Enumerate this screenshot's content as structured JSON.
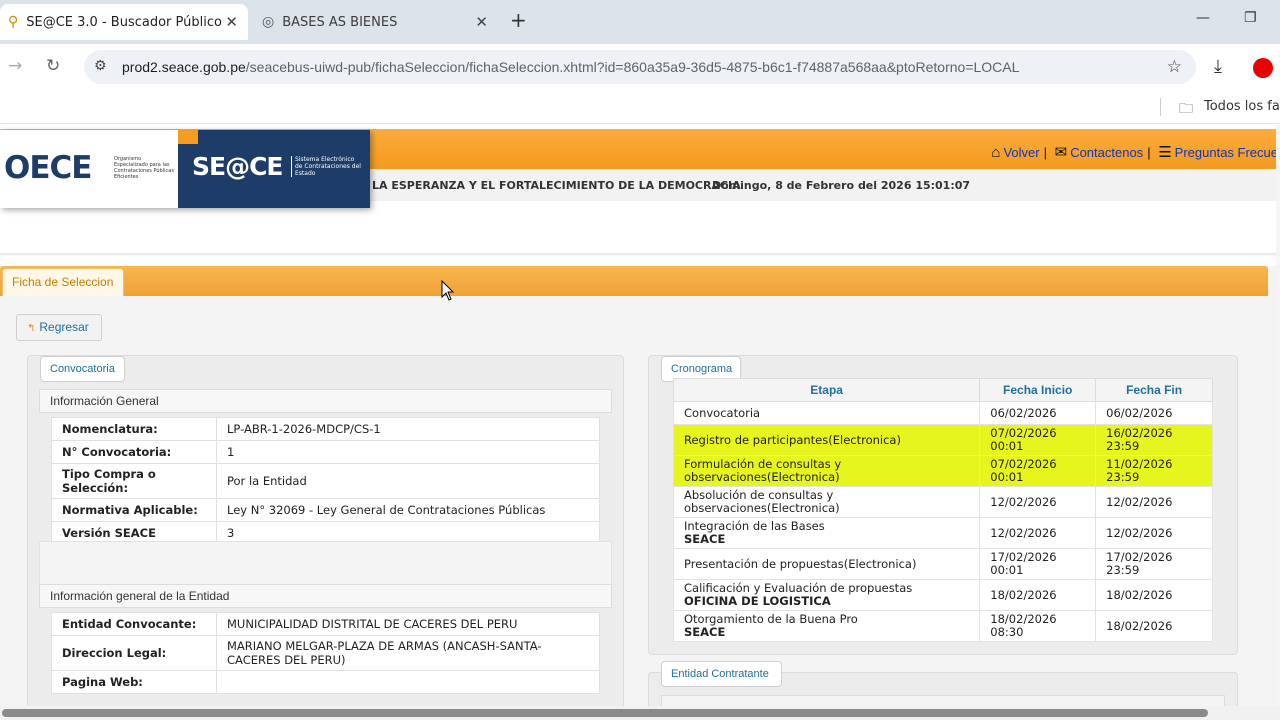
{
  "browser": {
    "tabs": [
      {
        "title": "SE@CE 3.0 - Buscador Público",
        "close": "✕"
      },
      {
        "title": "BASES AS BIENES",
        "close": "✕"
      }
    ],
    "new_tab": "+",
    "url_host": "prod2.seace.gob.pe",
    "url_path": "/seacebus-uiwd-pub/fichaSeleccion/fichaSeleccion.xhtml?id=860a35a9-36d5-4875-b6c1-f74887a568aa&ptoRetorno=LOCAL",
    "bookmarks_label": "Todos los fav"
  },
  "header": {
    "links": {
      "volver": "Volver",
      "contactenos": "Contactenos",
      "preguntas": "Preguntas Frecue"
    },
    "lema": "LA ESPERANZA Y EL FORTALECIMIENTO DE LA DEMOCRACIA",
    "fecha": "Domingo, 8 de Febrero del 2026  15:01:07",
    "oece_logo": "OECE",
    "oece_sub": "Organismo Especializado para las Contrataciones Públicas Eficientes",
    "seace_logo": "SE@CE",
    "seace_sub": "Sistema Electrónico de Contrataciones del Estado"
  },
  "ficha": {
    "tab": "Ficha de Seleccion",
    "regresar": "Regresar",
    "convocatoria": {
      "legend": "Convocatoria",
      "info_general_title": "Información General",
      "info_general": [
        {
          "label": "Nomenclatura:",
          "value": "LP-ABR-1-2026-MDCP/CS-1"
        },
        {
          "label": "N° Convocatoria:",
          "value": "1"
        },
        {
          "label": "Tipo Compra o Selección:",
          "value": "Por la Entidad"
        },
        {
          "label": "Normativa Aplicable:",
          "value": "Ley N° 32069 - Ley General de Contrataciones Públicas"
        },
        {
          "label": "Versión SEACE",
          "value": "3"
        }
      ],
      "entidad_title": "Información general de la Entidad",
      "entidad": [
        {
          "label": "Entidad Convocante:",
          "value": "MUNICIPALIDAD DISTRITAL DE CACERES DEL PERU"
        },
        {
          "label": "Direccion Legal:",
          "value": "MARIANO MELGAR-PLAZA DE ARMAS (ANCASH-SANTA-CACERES DEL PERU)"
        },
        {
          "label": "Pagina Web:",
          "value": ""
        }
      ]
    },
    "cronograma": {
      "legend": "Cronograma",
      "headers": [
        "Etapa",
        "Fecha Inicio",
        "Fecha Fin"
      ],
      "rows": [
        {
          "etapa": "Convocatoria",
          "sub": "",
          "inicio": "06/02/2026",
          "fin": "06/02/2026",
          "highlight": false
        },
        {
          "etapa": "Registro de participantes(Electronica)",
          "sub": "",
          "inicio": "07/02/2026 00:01",
          "fin": "16/02/2026 23:59",
          "highlight": true
        },
        {
          "etapa": "Formulación de consultas y observaciones(Electronica)",
          "sub": "",
          "inicio": "07/02/2026 00:01",
          "fin": "11/02/2026 23:59",
          "highlight": true
        },
        {
          "etapa": "Absolución de consultas y observaciones(Electronica)",
          "sub": "",
          "inicio": "12/02/2026",
          "fin": "12/02/2026",
          "highlight": false
        },
        {
          "etapa": "Integración de las Bases",
          "sub": "SEACE",
          "inicio": "12/02/2026",
          "fin": "12/02/2026",
          "highlight": false
        },
        {
          "etapa": "Presentación de propuestas(Electronica)",
          "sub": "",
          "inicio": "17/02/2026 00:01",
          "fin": "17/02/2026 23:59",
          "highlight": false
        },
        {
          "etapa": "Calificación y Evaluación de propuestas",
          "sub": "OFICINA DE LOGISTICA",
          "inicio": "18/02/2026",
          "fin": "18/02/2026",
          "highlight": false
        },
        {
          "etapa": "Otorgamiento de la Buena Pro",
          "sub": "SEACE",
          "inicio": "18/02/2026 08:30",
          "fin": "18/02/2026",
          "highlight": false
        }
      ]
    },
    "entidad_contratante": {
      "legend": "Entidad Contratante"
    }
  },
  "colors": {
    "highlight": "#e6f51e",
    "accent_orange": "#f39a1f",
    "link_blue": "#1f6f9f",
    "seace_navy": "#1e3c68"
  }
}
